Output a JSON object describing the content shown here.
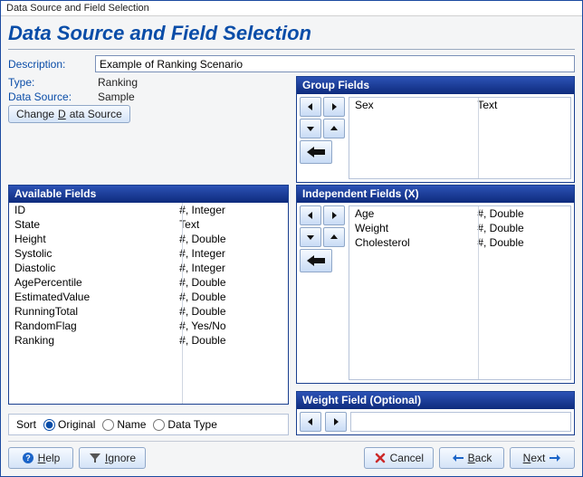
{
  "window": {
    "title": "Data Source and Field Selection"
  },
  "page": {
    "heading": "Data Source and Field Selection"
  },
  "form": {
    "description_label": "Description:",
    "description_value": "Example of Ranking Scenario",
    "type_label": "Type:",
    "type_value": "Ranking",
    "datasource_label": "Data Source:",
    "datasource_value": "Sample",
    "change_ds_prefix": "Change ",
    "change_ds_accel": "D",
    "change_ds_suffix": "ata Source"
  },
  "available": {
    "header": "Available Fields",
    "rows": [
      {
        "name": "ID",
        "type": "#, Integer"
      },
      {
        "name": "State",
        "type": "Text"
      },
      {
        "name": "Height",
        "type": "#, Double"
      },
      {
        "name": "Systolic",
        "type": "#, Integer"
      },
      {
        "name": "Diastolic",
        "type": "#, Integer"
      },
      {
        "name": "AgePercentile",
        "type": "#, Double"
      },
      {
        "name": "EstimatedValue",
        "type": "#, Double"
      },
      {
        "name": "RunningTotal",
        "type": "#, Double"
      },
      {
        "name": "RandomFlag",
        "type": "#, Yes/No"
      },
      {
        "name": "Ranking",
        "type": "#, Double"
      }
    ]
  },
  "group": {
    "header": "Group Fields",
    "rows": [
      {
        "name": "Sex",
        "type": "Text"
      }
    ]
  },
  "independent": {
    "header": "Independent Fields (X)",
    "rows": [
      {
        "name": "Age",
        "type": "#, Double"
      },
      {
        "name": "Weight",
        "type": "#, Double"
      },
      {
        "name": "Cholesterol",
        "type": "#, Double"
      }
    ]
  },
  "weight": {
    "header": "Weight Field (Optional)",
    "value": ""
  },
  "sort": {
    "label": "Sort",
    "options": {
      "original": "Original",
      "name": "Name",
      "datatype": "Data Type"
    },
    "selected": "original"
  },
  "buttons": {
    "help_accel": "H",
    "help_suffix": "elp",
    "ignore_accel": "I",
    "ignore_suffix": "gnore",
    "cancel": "Cancel",
    "back_accel": "B",
    "back_suffix": "ack",
    "next_accel": "N",
    "next_suffix": "ext"
  }
}
